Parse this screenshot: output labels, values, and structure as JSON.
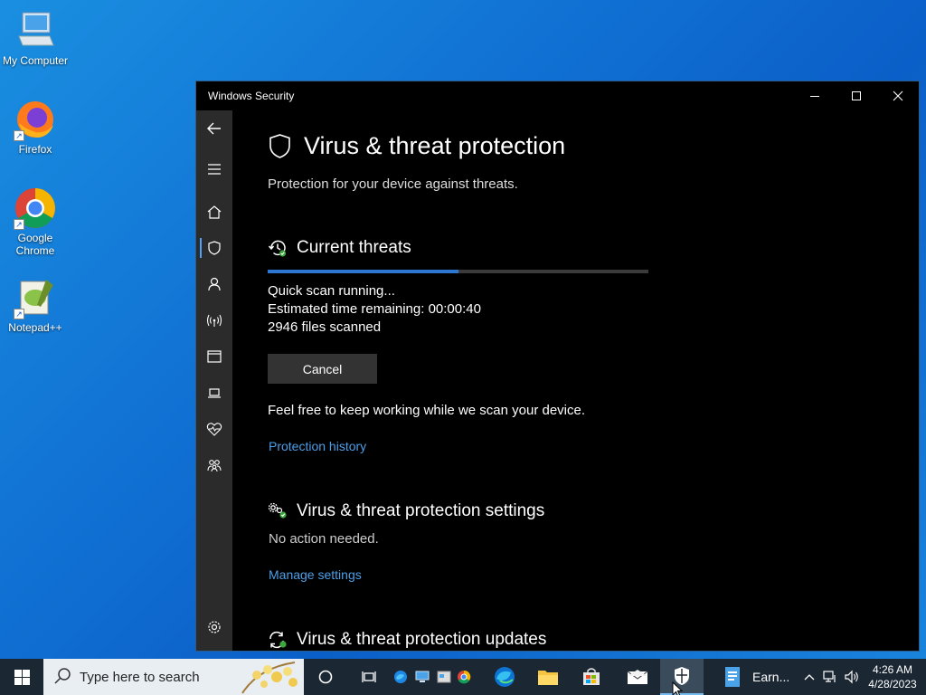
{
  "desktop": {
    "icons": [
      {
        "label": "My Computer"
      },
      {
        "label": "Firefox"
      },
      {
        "label": "Google Chrome"
      },
      {
        "label": "Notepad++"
      }
    ]
  },
  "window": {
    "title": "Windows Security",
    "minimize": "—",
    "maximize": "☐",
    "close": "✕"
  },
  "page": {
    "title": "Virus & threat protection",
    "subtitle": "Protection for your device against threats."
  },
  "current_threats": {
    "heading": "Current threats",
    "progress": 0.5,
    "status": "Quick scan running...",
    "time_remaining": "Estimated time remaining: 00:00:40",
    "files_scanned": "2946 files scanned",
    "cancel_label": "Cancel",
    "info": "Feel free to keep working while we scan your device.",
    "history_link": "Protection history"
  },
  "settings_section": {
    "heading": "Virus & threat protection settings",
    "status": "No action needed.",
    "link": "Manage settings"
  },
  "updates_section": {
    "heading": "Virus & threat protection updates"
  },
  "taskbar": {
    "search_placeholder": "Type here to search",
    "earn_label": "Earn...",
    "time": "4:26 AM",
    "date": "4/28/2023"
  },
  "colors": {
    "accent": "#2e77d0",
    "link": "#4b9fe8",
    "window_bg": "#000000",
    "sidebar_bg": "#2b2b2b",
    "taskbar_bg": "#1b2733"
  }
}
